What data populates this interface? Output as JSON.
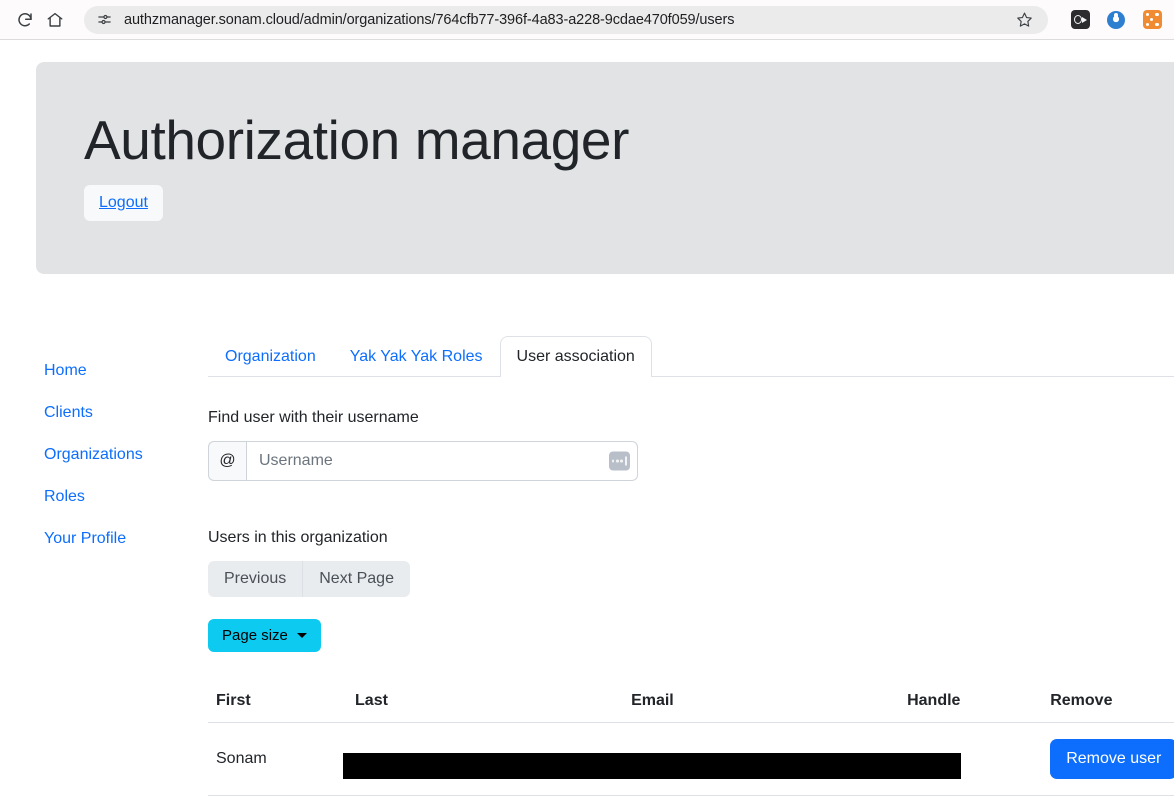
{
  "browser": {
    "reload_icon": "reload-icon",
    "home_icon": "home-icon",
    "site_settings_icon": "site-settings-icon",
    "url": "authzmanager.sonam.cloud/admin/organizations/764cfb77-396f-4a83-a228-9cdae470f059/users",
    "bookmark_icon": "star-icon",
    "extensions": [
      {
        "name": "extension-icon-dark",
        "color": "#2c2c2e"
      },
      {
        "name": "extension-icon-blue",
        "color": "#2f7fd1"
      },
      {
        "name": "extension-icon-orange",
        "color": "#f08b32"
      }
    ]
  },
  "header": {
    "title": "Authorization manager",
    "logout_label": "Logout"
  },
  "sidebar": {
    "items": [
      {
        "label": "Home"
      },
      {
        "label": "Clients"
      },
      {
        "label": "Organizations"
      },
      {
        "label": "Roles"
      },
      {
        "label": "Your Profile"
      }
    ]
  },
  "tabs": [
    {
      "label": "Organization",
      "active": false
    },
    {
      "label": "Yak Yak Yak Roles",
      "active": false
    },
    {
      "label": "User association",
      "active": true
    }
  ],
  "find_user": {
    "label": "Find user with their username",
    "addon": "@",
    "placeholder": "Username",
    "value": "",
    "password_manager_icon": "password-manager-icon"
  },
  "users_section": {
    "label": "Users in this organization",
    "previous_label": "Previous",
    "next_label": "Next Page",
    "page_size_label": "Page size"
  },
  "table": {
    "columns": [
      "First",
      "Last",
      "Email",
      "Handle",
      "Remove"
    ],
    "rows": [
      {
        "first": "Sonam",
        "last": "",
        "email": "",
        "handle": "",
        "remove_label": "Remove user",
        "redacted": true
      }
    ]
  },
  "colors": {
    "link": "#0d6efd",
    "primary": "#0d6efd",
    "info": "#0dcaf0",
    "header_bg": "#e2e3e5",
    "secondary_light": "#e9ecef"
  }
}
